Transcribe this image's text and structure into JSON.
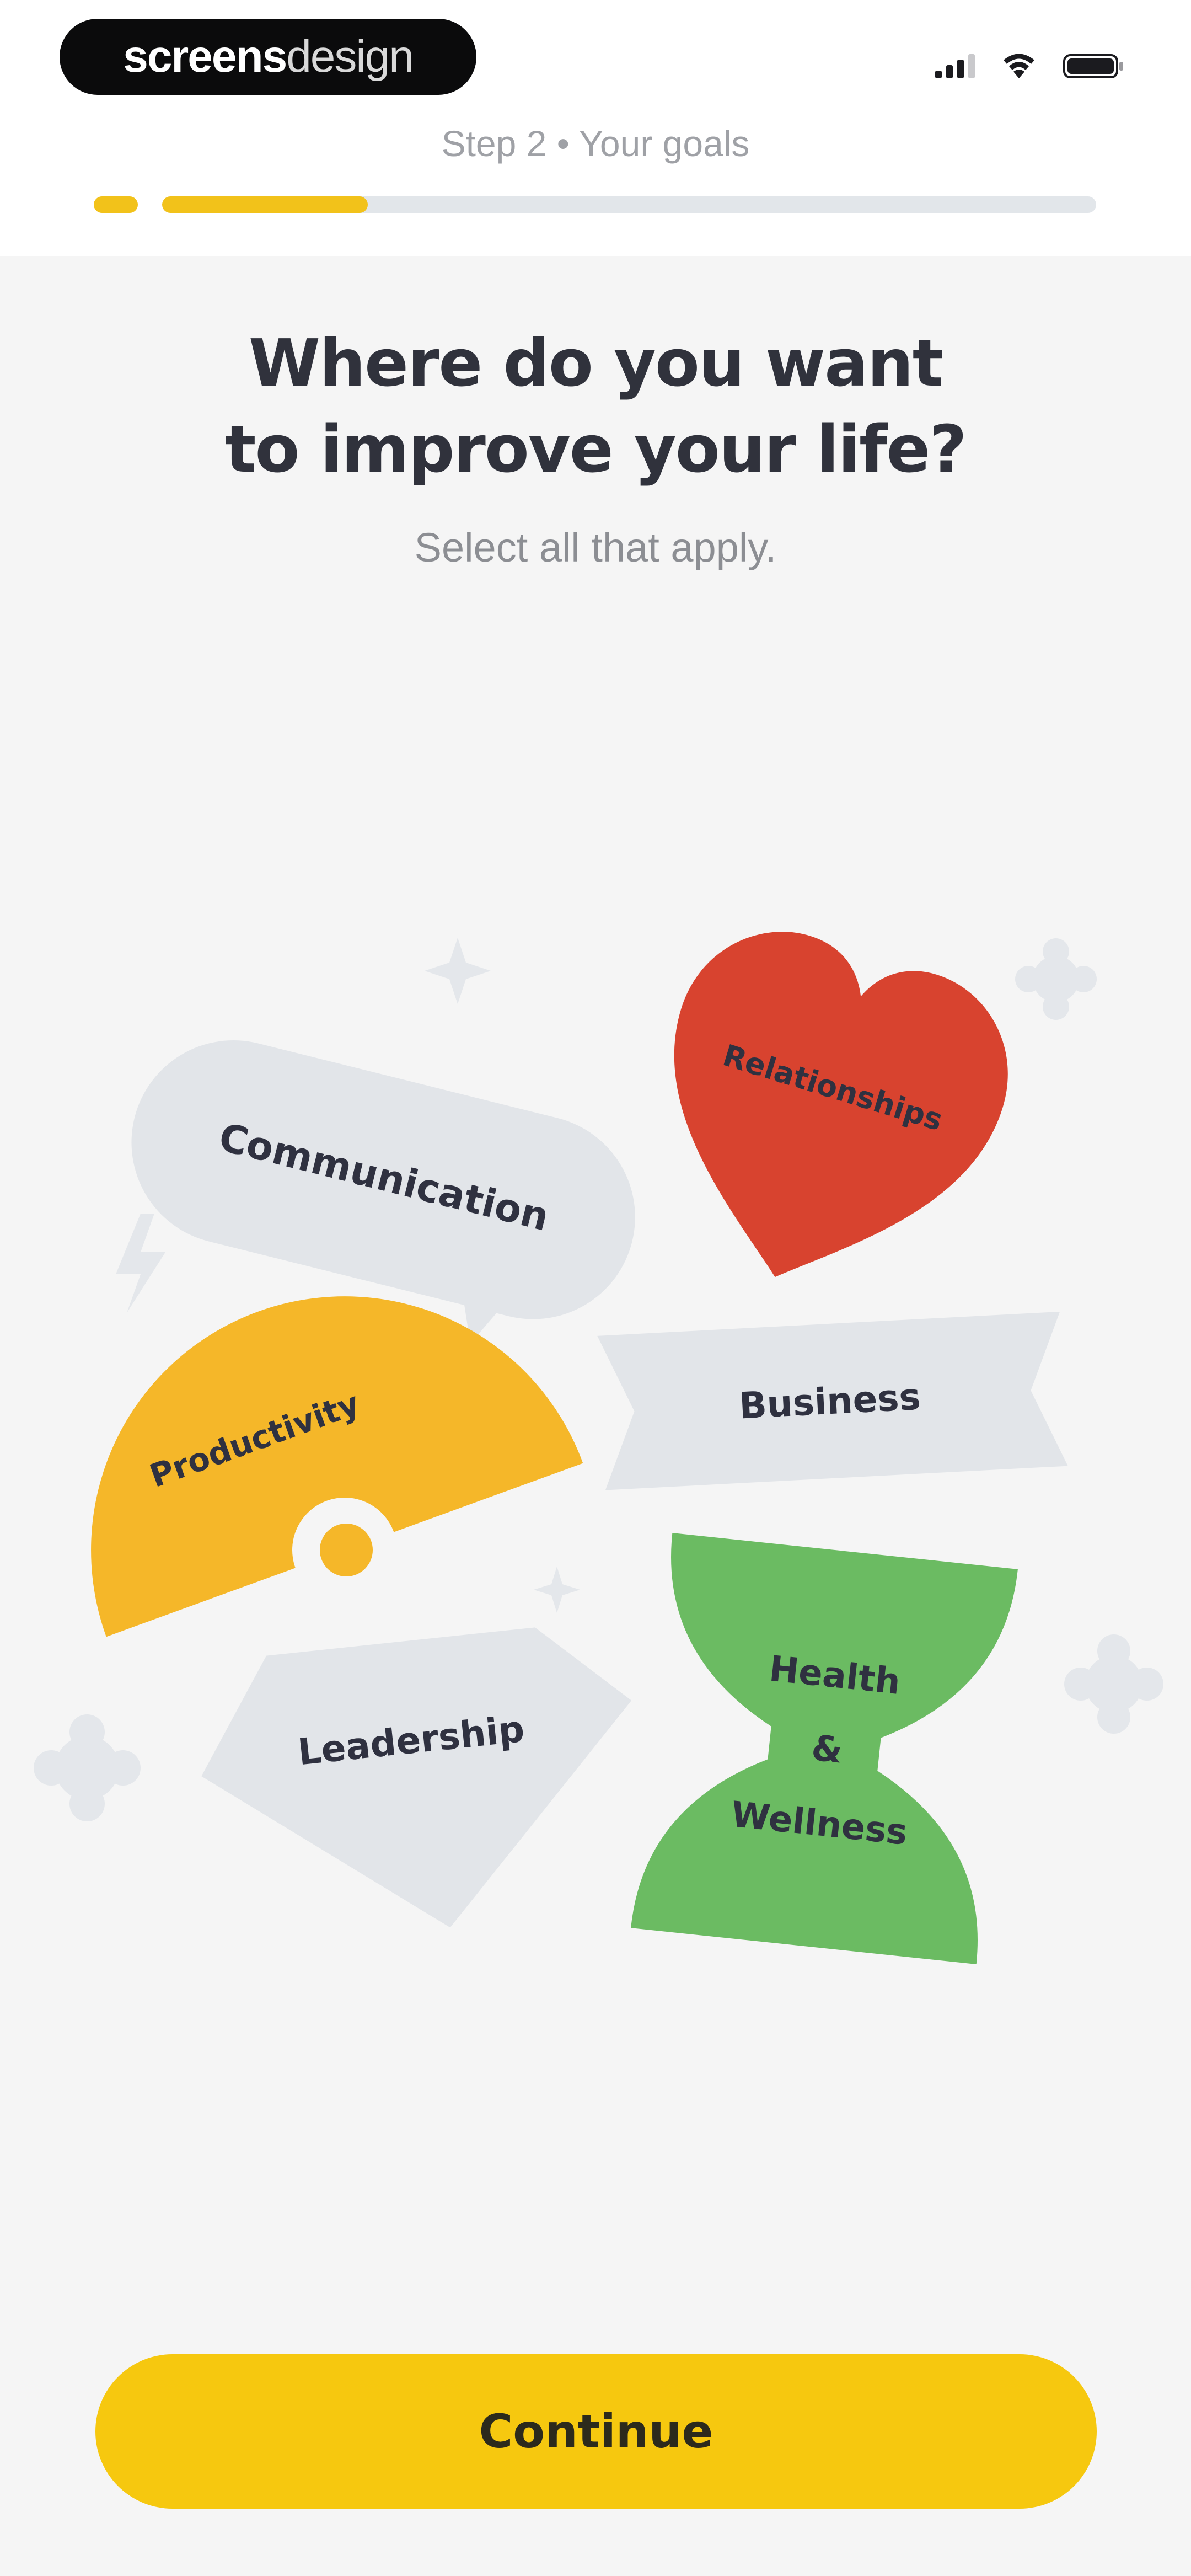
{
  "brand": {
    "part1": "screens",
    "part2": "design"
  },
  "header": {
    "step_label": "Step 2 • Your goals",
    "progress": 0.22
  },
  "main": {
    "title_line1": "Where do you want",
    "title_line2": "to improve your life?",
    "subtitle": "Select all that apply."
  },
  "goals": {
    "communication": "Communication",
    "relationships": "Relationships",
    "productivity": "Productivity",
    "business": "Business",
    "leadership": "Leadership",
    "health_line1": "Health",
    "health_line2": "&",
    "health_line3": "Wellness"
  },
  "colors": {
    "accent": "#f6c80f",
    "heart": "#d8432f",
    "health": "#6bbb62",
    "productivity": "#f5b729",
    "neutral_shape": "#e2e5e9"
  },
  "footer": {
    "continue_label": "Continue"
  }
}
